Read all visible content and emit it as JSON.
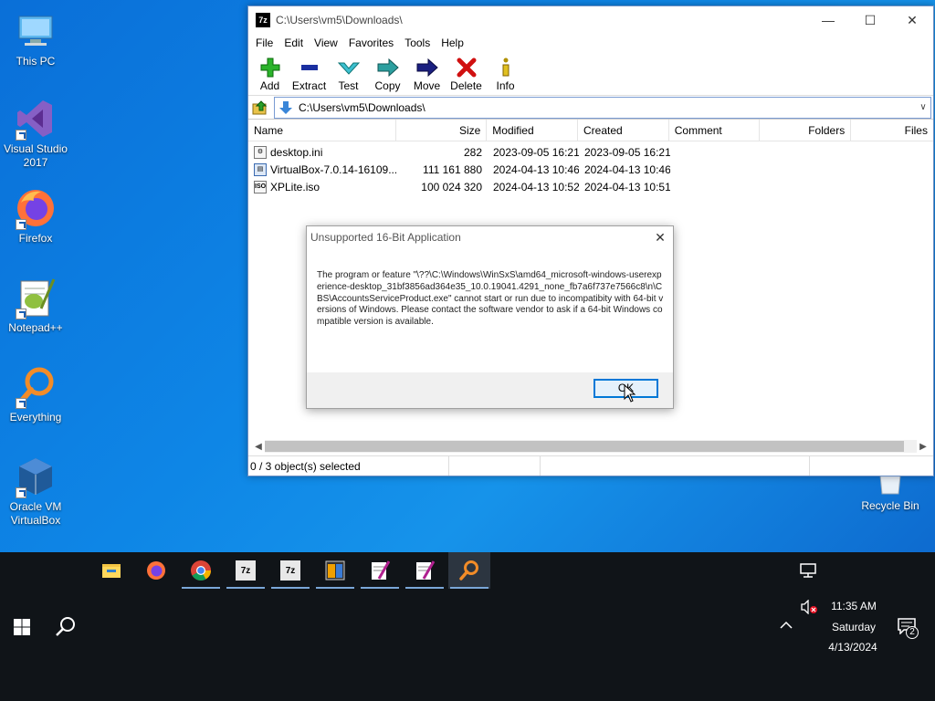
{
  "desktop": {
    "icons": [
      {
        "label": "This PC"
      },
      {
        "label": "Visual Studio 2017"
      },
      {
        "label": "Firefox"
      },
      {
        "label": "Notepad++"
      },
      {
        "label": "Everything"
      },
      {
        "label": "Oracle VM VirtualBox"
      },
      {
        "label": "Recycle Bin"
      }
    ]
  },
  "window": {
    "title": "C:\\Users\\vm5\\Downloads\\",
    "app_icon_text": "7z",
    "menu": [
      "File",
      "Edit",
      "View",
      "Favorites",
      "Tools",
      "Help"
    ],
    "toolbar": {
      "add": "Add",
      "extract": "Extract",
      "test": "Test",
      "copy": "Copy",
      "move": "Move",
      "delete": "Delete",
      "info": "Info"
    },
    "address": "C:\\Users\\vm5\\Downloads\\",
    "columns": {
      "name": "Name",
      "size": "Size",
      "modified": "Modified",
      "created": "Created",
      "comment": "Comment",
      "folders": "Folders",
      "files": "Files"
    },
    "rows": [
      {
        "name": "desktop.ini",
        "size": "282",
        "modified": "2023-09-05 16:21",
        "created": "2023-09-05 16:21"
      },
      {
        "name": "VirtualBox-7.0.14-16109...",
        "size": "111 161 880",
        "modified": "2024-04-13 10:46",
        "created": "2024-04-13 10:46"
      },
      {
        "name": "XPLite.iso",
        "size": "100 024 320",
        "modified": "2024-04-13 10:52",
        "created": "2024-04-13 10:51"
      }
    ],
    "status": "0 / 3 object(s) selected"
  },
  "dialog": {
    "title": "Unsupported 16-Bit Application",
    "message": "The program or feature \"\\??\\C:\\Windows\\WinSxS\\amd64_microsoft-windows-userexperience-desktop_31bf3856ad364e35_10.0.19041.4291_none_fb7a6f737e7566c8\\n\\CBS\\AccountsServiceProduct.exe\" cannot start or run due to incompatibity with 64-bit versions of Windows. Please contact the software vendor to ask if a 64-bit Windows compatible version is available.",
    "ok": "OK"
  },
  "taskbar": {
    "sevenzip_label": "7z",
    "time": "11:35 AM",
    "day": "Saturday",
    "date": "4/13/2024",
    "notifications": "2"
  }
}
